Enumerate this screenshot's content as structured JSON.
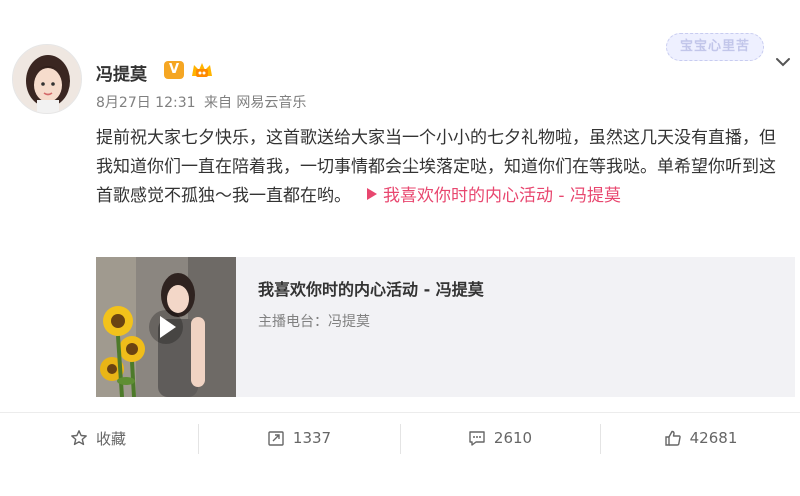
{
  "post": {
    "username": "冯提莫",
    "verified_glyph": "V",
    "date": "8月27日 12:31",
    "source": "来自 网易云音乐",
    "text": "提前祝大家七夕快乐，这首歌送给大家当一个小小的七夕礼物啦，虽然这几天没有直播，但我知道你们一直在陪着我，一切事情都会尘埃落定哒，知道你们在等我哒。单希望你听到这首歌感觉不孤独～我一直都在哟。",
    "link_text": "我喜欢你时的内心活动 - 冯提莫",
    "badge_text": "宝宝心里苦"
  },
  "media": {
    "title": "我喜欢你时的内心活动 - 冯提莫",
    "subtitle": "主播电台：冯提莫"
  },
  "actions": {
    "favorite": {
      "label": "收藏",
      "icon": "star-icon"
    },
    "repost": {
      "count": "1337",
      "icon": "repost-icon"
    },
    "comment": {
      "count": "2610",
      "icon": "comment-icon"
    },
    "like": {
      "count": "42681",
      "icon": "thumbs-up-icon"
    }
  },
  "colors": {
    "accent_link": "#e8476f",
    "verified": "#f5a623",
    "meta_gray": "#808080"
  }
}
